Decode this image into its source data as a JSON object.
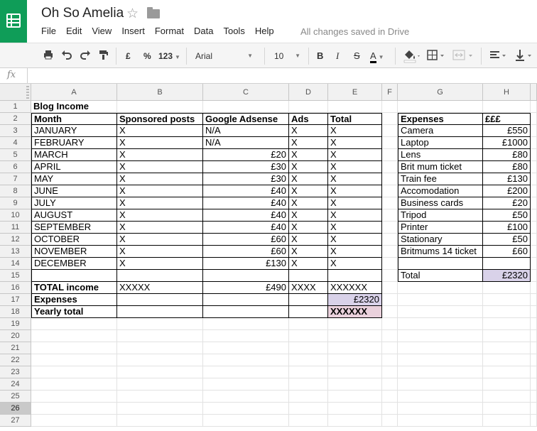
{
  "app": {
    "title": "Oh So Amelia",
    "save_status": "All changes saved in Drive",
    "menu": [
      "File",
      "Edit",
      "View",
      "Insert",
      "Format",
      "Data",
      "Tools",
      "Help"
    ]
  },
  "toolbar": {
    "currency_label": "£",
    "percent_label": "%",
    "number_format_label": "123",
    "font_name": "Arial",
    "font_size": "10",
    "bold_label": "B",
    "italic_label": "I",
    "strike_label": "S",
    "text_color_label": "A",
    "icons": [
      "print-icon",
      "undo-icon",
      "redo-icon",
      "paint-format-icon",
      "fill-color-icon",
      "borders-icon",
      "merge-icon",
      "align-icon",
      "valign-icon"
    ]
  },
  "formula_bar": {
    "fx_label": "fx",
    "value": ""
  },
  "colors": {
    "brand": "#0f9d58",
    "expenses_total": "#d9d2e9",
    "yearly_total": "#ead1dc"
  },
  "sheet": {
    "columns": [
      "A",
      "B",
      "C",
      "D",
      "E",
      "F",
      "G",
      "H"
    ],
    "rows": [
      "1",
      "2",
      "3",
      "4",
      "5",
      "6",
      "7",
      "8",
      "9",
      "10",
      "11",
      "12",
      "13",
      "14",
      "15",
      "16",
      "17",
      "18",
      "19",
      "20",
      "21",
      "22",
      "23",
      "24",
      "25",
      "26",
      "27"
    ],
    "selected_row": "26",
    "income": {
      "title": "Blog Income",
      "headers": [
        "Month",
        "Sponsored posts",
        "Google Adsense",
        "Ads",
        "Total"
      ],
      "months": [
        {
          "month": "JANUARY",
          "sponsored": "X",
          "adsense": "N/A",
          "ads": "X",
          "total": "X"
        },
        {
          "month": "FEBRUARY",
          "sponsored": "X",
          "adsense": "N/A",
          "ads": "X",
          "total": "X"
        },
        {
          "month": "MARCH",
          "sponsored": "X",
          "adsense": "£20",
          "ads": "X",
          "total": "X"
        },
        {
          "month": "APRIL",
          "sponsored": "X",
          "adsense": "£30",
          "ads": "X",
          "total": "X"
        },
        {
          "month": "MAY",
          "sponsored": "X",
          "adsense": "£30",
          "ads": "X",
          "total": "X"
        },
        {
          "month": "JUNE",
          "sponsored": "X",
          "adsense": "£40",
          "ads": "X",
          "total": "X"
        },
        {
          "month": "JULY",
          "sponsored": "X",
          "adsense": "£40",
          "ads": "X",
          "total": "X"
        },
        {
          "month": "AUGUST",
          "sponsored": "X",
          "adsense": "£40",
          "ads": "X",
          "total": "X"
        },
        {
          "month": "SEPTEMBER",
          "sponsored": "X",
          "adsense": "£40",
          "ads": "X",
          "total": "X"
        },
        {
          "month": "OCTOBER",
          "sponsored": "X",
          "adsense": "£60",
          "ads": "X",
          "total": "X"
        },
        {
          "month": "NOVEMBER",
          "sponsored": "X",
          "adsense": "£60",
          "ads": "X",
          "total": "X"
        },
        {
          "month": "DECEMBER",
          "sponsored": "X",
          "adsense": "£130",
          "ads": "X",
          "total": "X"
        }
      ],
      "total_row": {
        "label": "TOTAL income",
        "sponsored": "XXXXX",
        "adsense": "£490",
        "ads": "XXXX",
        "total": "XXXXXX"
      },
      "expenses_row": {
        "label": "Expenses",
        "total": "£2320"
      },
      "yearly_row": {
        "label": "Yearly total",
        "total": "XXXXXX"
      }
    },
    "expenses": {
      "headers": [
        "Expenses",
        "£££"
      ],
      "items": [
        {
          "name": "Camera",
          "cost": "£550"
        },
        {
          "name": "Laptop",
          "cost": "£1000"
        },
        {
          "name": "Lens",
          "cost": "£80"
        },
        {
          "name": "Brit mum ticket",
          "cost": "£80"
        },
        {
          "name": "Train fee",
          "cost": "£130"
        },
        {
          "name": "Accomodation",
          "cost": "£200"
        },
        {
          "name": "Business cards",
          "cost": "£20"
        },
        {
          "name": "Tripod",
          "cost": "£50"
        },
        {
          "name": "Printer",
          "cost": "£100"
        },
        {
          "name": "Stationary",
          "cost": "£50"
        },
        {
          "name": "Britmums 14 ticket",
          "cost": "£60"
        }
      ],
      "total_label": "Total",
      "total_value": "£2320"
    }
  }
}
